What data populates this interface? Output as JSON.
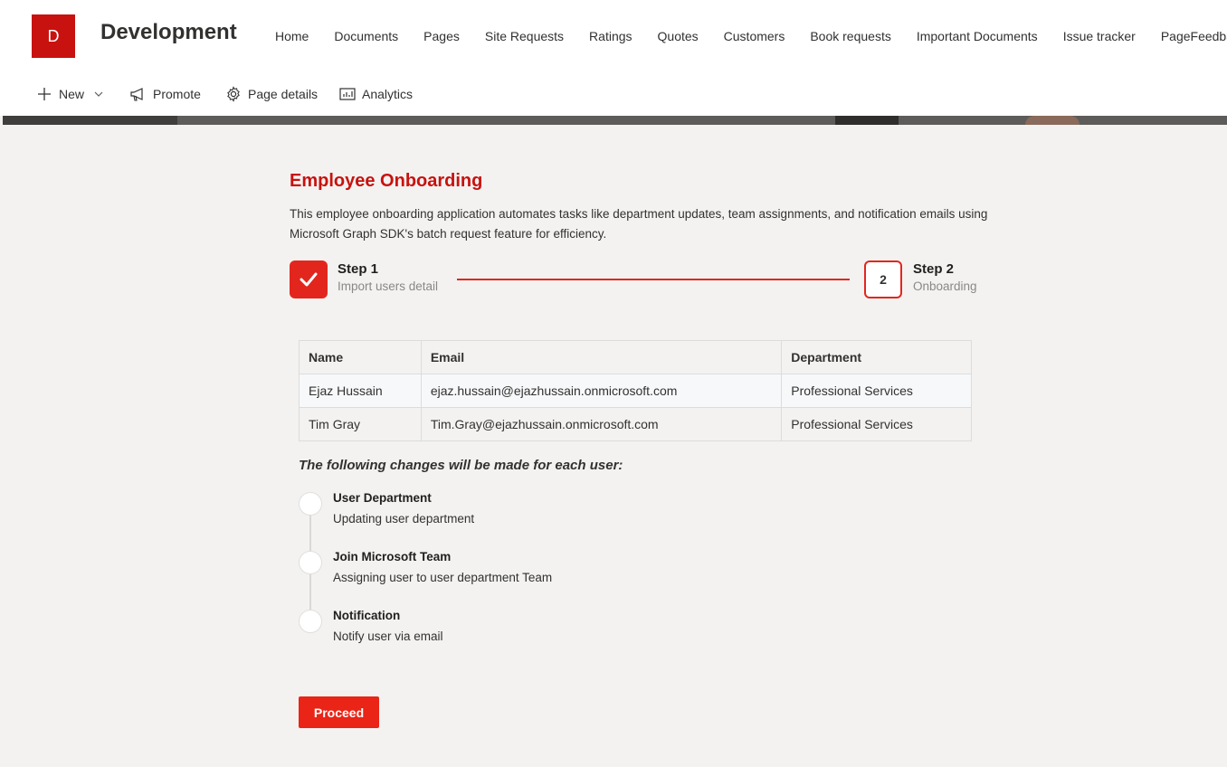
{
  "site": {
    "logo_letter": "D",
    "title": "Development",
    "nav": [
      "Home",
      "Documents",
      "Pages",
      "Site Requests",
      "Ratings",
      "Quotes",
      "Customers",
      "Book requests",
      "Important Documents",
      "Issue tracker",
      "PageFeedback"
    ]
  },
  "command_bar": {
    "new_label": "New",
    "promote_label": "Promote",
    "page_details_label": "Page details",
    "analytics_label": "Analytics"
  },
  "main": {
    "title": "Employee Onboarding",
    "description": "This employee onboarding application automates tasks like department updates, team assignments, and notification emails using Microsoft Graph SDK's batch request feature for efficiency.",
    "steps": [
      {
        "name": "Step 1",
        "subtitle": "Import users detail",
        "status": "completed"
      },
      {
        "name": "Step 2",
        "subtitle": "Onboarding",
        "number": "2",
        "status": "active"
      }
    ],
    "table": {
      "headers": [
        "Name",
        "Email",
        "Department"
      ],
      "rows": [
        [
          "Ejaz Hussain",
          "ejaz.hussain@ejazhussain.onmicrosoft.com",
          "Professional Services"
        ],
        [
          "Tim Gray",
          "Tim.Gray@ejazhussain.onmicrosoft.com",
          "Professional Services"
        ]
      ]
    },
    "changes_heading": "The following changes will be made for each user:",
    "changes": [
      {
        "title": "User Department",
        "description": "Updating user department"
      },
      {
        "title": "Join Microsoft Team",
        "description": "Assigning user to user department Team"
      },
      {
        "title": "Notification",
        "description": "Notify user via email"
      }
    ],
    "proceed_label": "Proceed"
  },
  "colors": {
    "accent": "#e3261d",
    "logo": "#c8120f",
    "title": "#c8120f",
    "page_bg": "#f3f2f1"
  },
  "icons": {
    "new": "plus-icon",
    "new_menu": "chevron-down-icon",
    "promote": "megaphone-icon",
    "page_details": "gear-icon",
    "analytics": "chart-icon",
    "step1": "checkmark-icon"
  }
}
